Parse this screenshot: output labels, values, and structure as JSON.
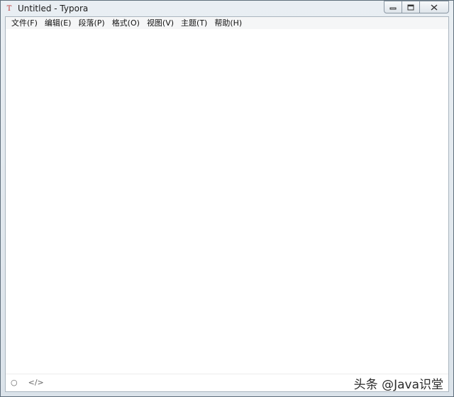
{
  "window": {
    "title": "Untitled - Typora",
    "app_icon_glyph": "T",
    "minimize_icon": "minimize-icon",
    "maximize_icon": "maximize-icon",
    "close_icon": "close-icon"
  },
  "menu": {
    "items": [
      {
        "label": "文件(F)"
      },
      {
        "label": "编辑(E)"
      },
      {
        "label": "段落(P)"
      },
      {
        "label": "格式(O)"
      },
      {
        "label": "视图(V)"
      },
      {
        "label": "主题(T)"
      },
      {
        "label": "帮助(H)"
      }
    ]
  },
  "status": {
    "outline_glyph": "○",
    "source_glyph": "</>"
  },
  "watermark": {
    "text": "头条 @Java识堂"
  }
}
